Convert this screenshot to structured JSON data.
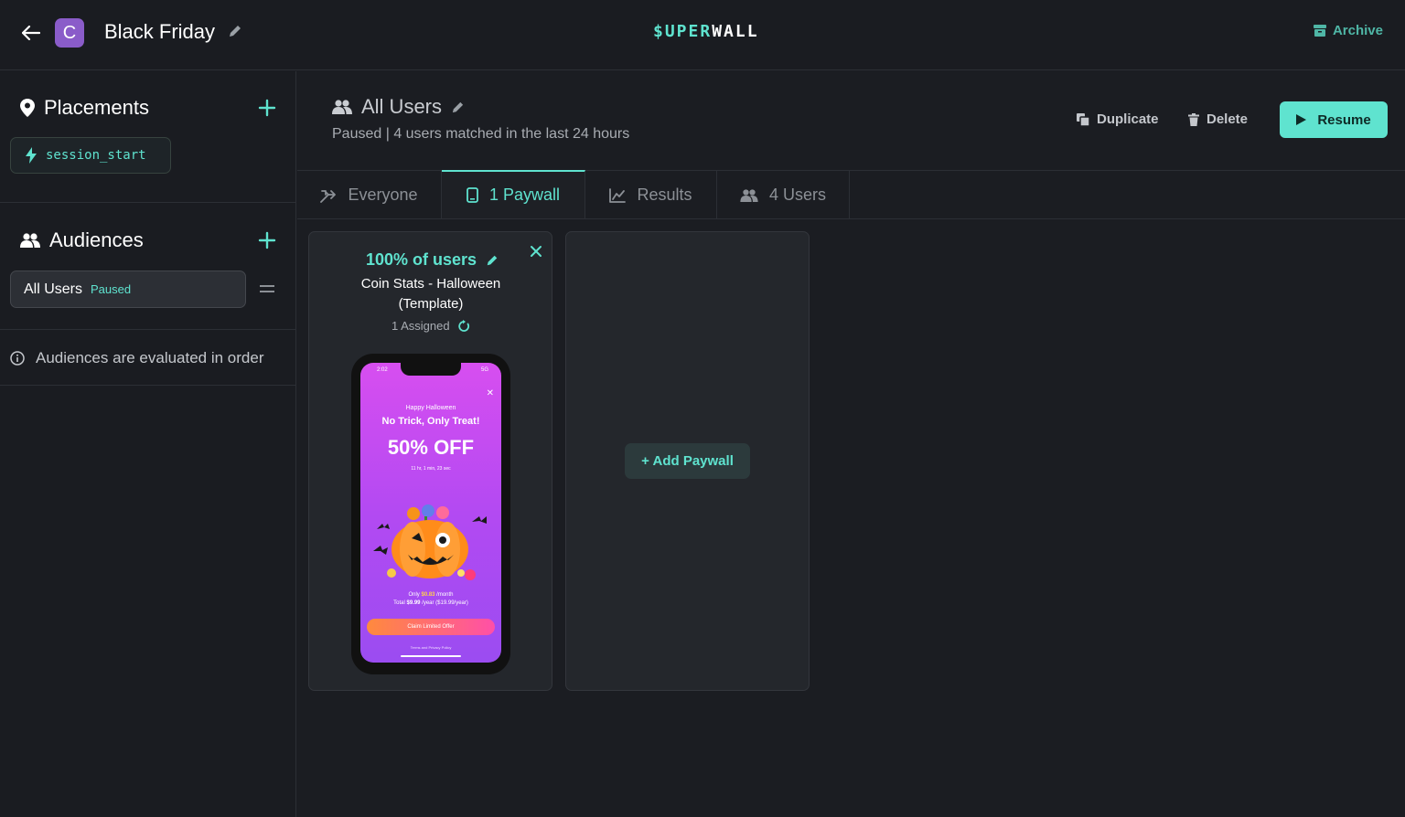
{
  "topbar": {
    "app_initial": "C",
    "campaign_title": "Black Friday",
    "logo_part1": "$UPER",
    "logo_part2": "WALL",
    "archive_label": "Archive"
  },
  "sidebar": {
    "placements_title": "Placements",
    "placement_chip": "session_start",
    "audiences_title": "Audiences",
    "audience_name": "All Users",
    "audience_status": "Paused",
    "info_text": "Audiences are evaluated in order"
  },
  "audience": {
    "title": "All Users",
    "status_line": "Paused | 4 users matched in the last 24 hours",
    "duplicate_label": "Duplicate",
    "delete_label": "Delete",
    "resume_label": "Resume"
  },
  "tabs": [
    {
      "label": "Everyone",
      "icon": "split-icon"
    },
    {
      "label": "1 Paywall",
      "icon": "phone-icon",
      "active": true
    },
    {
      "label": "Results",
      "icon": "chart-icon"
    },
    {
      "label": "4 Users",
      "icon": "users-icon"
    }
  ],
  "paywall_card": {
    "percent_label": "100% of users",
    "name": "Coin Stats - Halloween (Template)",
    "assigned": "1 Assigned"
  },
  "phone_preview": {
    "time": "2:02",
    "status_right": "5G",
    "greeting": "Happy Halloween",
    "headline": "No Trick, Only Treat!",
    "offer": "50% OFF",
    "countdown": "11 hr, 1 min, 23 sec",
    "price_line1_prefix": "Only",
    "price_month": "$0.83",
    "price_line1_suffix": "/month",
    "price_line2_prefix": "Total",
    "price_year": "$9.99",
    "price_line2_suffix": "/year ($19.99/year)",
    "cta": "Claim Limited Offer",
    "terms": "Terms and Privacy Policy"
  },
  "add_paywall_label": "+ Add Paywall",
  "colors": {
    "accent": "#5fe3cf",
    "background": "#1b1d22",
    "app_icon": "#8a5cc9"
  }
}
